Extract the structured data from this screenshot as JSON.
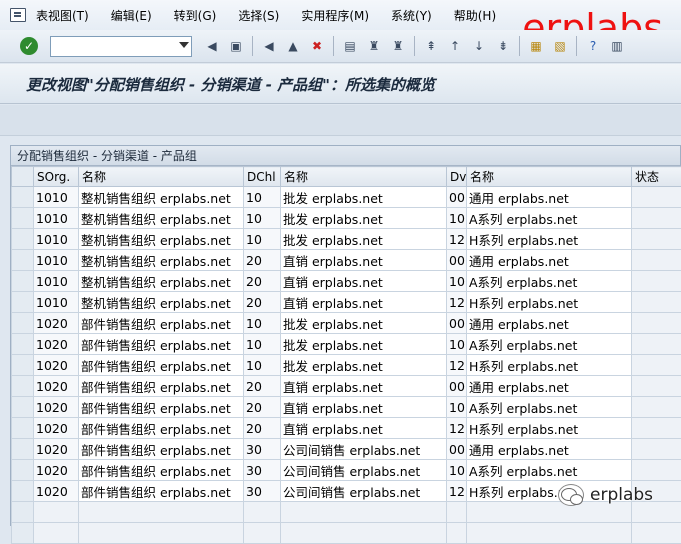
{
  "menu": {
    "items": [
      "表视图(T)",
      "编辑(E)",
      "转到(G)",
      "选择(S)",
      "实用程序(M)",
      "系统(Y)",
      "帮助(H)"
    ]
  },
  "brand": "erplabs",
  "command_field": {
    "value": ""
  },
  "title": "更改视图\"分配销售组织 - 分销渠道 - 产品组\"：所选集的概览",
  "grid": {
    "title": "分配销售组织 - 分销渠道 - 产品组",
    "columns": [
      "SOrg.",
      "名称",
      "DChl",
      "名称",
      "Dv",
      "名称",
      "状态"
    ],
    "rows": [
      [
        "1010",
        "整机销售组织 erplabs.net",
        "10",
        "批发 erplabs.net",
        "00",
        "通用 erplabs.net"
      ],
      [
        "1010",
        "整机销售组织 erplabs.net",
        "10",
        "批发 erplabs.net",
        "10",
        "A系列 erplabs.net"
      ],
      [
        "1010",
        "整机销售组织 erplabs.net",
        "10",
        "批发 erplabs.net",
        "12",
        "H系列 erplabs.net"
      ],
      [
        "1010",
        "整机销售组织 erplabs.net",
        "20",
        "直销 erplabs.net",
        "00",
        "通用 erplabs.net"
      ],
      [
        "1010",
        "整机销售组织 erplabs.net",
        "20",
        "直销 erplabs.net",
        "10",
        "A系列 erplabs.net"
      ],
      [
        "1010",
        "整机销售组织 erplabs.net",
        "20",
        "直销 erplabs.net",
        "12",
        "H系列 erplabs.net"
      ],
      [
        "1020",
        "部件销售组织 erplabs.net",
        "10",
        "批发 erplabs.net",
        "00",
        "通用 erplabs.net"
      ],
      [
        "1020",
        "部件销售组织 erplabs.net",
        "10",
        "批发 erplabs.net",
        "10",
        "A系列 erplabs.net"
      ],
      [
        "1020",
        "部件销售组织 erplabs.net",
        "10",
        "批发 erplabs.net",
        "12",
        "H系列 erplabs.net"
      ],
      [
        "1020",
        "部件销售组织 erplabs.net",
        "20",
        "直销 erplabs.net",
        "00",
        "通用 erplabs.net"
      ],
      [
        "1020",
        "部件销售组织 erplabs.net",
        "20",
        "直销 erplabs.net",
        "10",
        "A系列 erplabs.net"
      ],
      [
        "1020",
        "部件销售组织 erplabs.net",
        "20",
        "直销 erplabs.net",
        "12",
        "H系列 erplabs.net"
      ],
      [
        "1020",
        "部件销售组织 erplabs.net",
        "30",
        "公司间销售 erplabs.net",
        "00",
        "通用 erplabs.net"
      ],
      [
        "1020",
        "部件销售组织 erplabs.net",
        "30",
        "公司间销售 erplabs.net",
        "10",
        "A系列 erplabs.net"
      ],
      [
        "1020",
        "部件销售组织 erplabs.net",
        "30",
        "公司间销售 erplabs.net",
        "12",
        "H系列 erplabs.net"
      ]
    ]
  },
  "watermark": "erplabs",
  "colors": {
    "brand": "#ee1111",
    "accent_ok": "#2f8b2f"
  }
}
